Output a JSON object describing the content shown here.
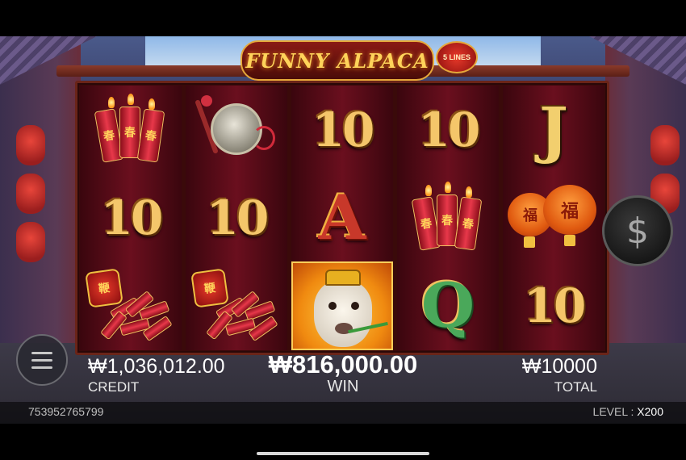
{
  "logo": {
    "title": "FUNNY ALPACA",
    "lines_badge": "5 LINES"
  },
  "reels": [
    [
      "firecrackers",
      "10",
      "fireworks"
    ],
    [
      "gong",
      "10",
      "fireworks"
    ],
    [
      "10",
      "A",
      "alpaca-wild"
    ],
    [
      "10",
      "firecrackers",
      "Q"
    ],
    [
      "J",
      "lanterns",
      "10"
    ]
  ],
  "symbols": {
    "ten": "10",
    "letter_a": "A",
    "letter_j": "J",
    "letter_q": "Q",
    "firecracker_char": "春",
    "lantern_char": "福",
    "fireworks_char": "鞭"
  },
  "controls": {
    "dollar_button": "$"
  },
  "hud": {
    "credit_value": "₩1,036,012.00",
    "credit_label": "CREDIT",
    "win_value": "₩816,000.00",
    "win_label": "WIN",
    "total_value": "₩10000",
    "total_label": "TOTAL"
  },
  "footer": {
    "game_id": "753952765799",
    "level_label": "LEVEL : ",
    "level_value": "X200"
  },
  "colors": {
    "reel_bg": "#6a0f1e",
    "gold": "#f4c66a",
    "win_highlight": "#ffcc40"
  }
}
